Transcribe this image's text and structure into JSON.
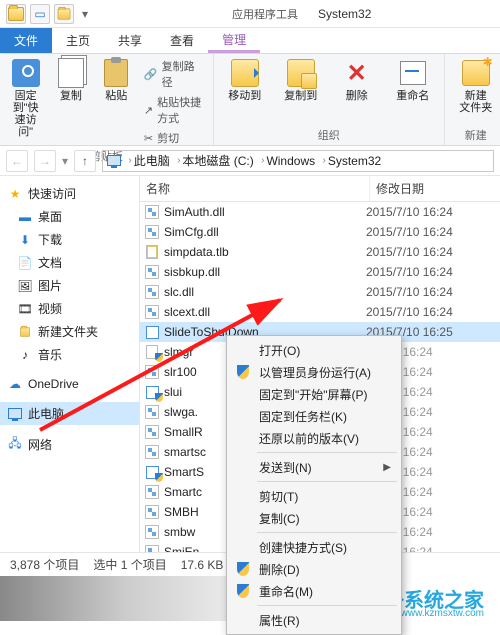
{
  "titlebar": {
    "contextual_tab": "应用程序工具",
    "window_title": "System32"
  },
  "tabs": {
    "file": "文件",
    "home": "主页",
    "share": "共享",
    "view": "查看",
    "manage": "管理"
  },
  "ribbon": {
    "pin": "固定到\"快\n速访问\"",
    "copy": "复制",
    "paste": "粘贴",
    "copy_path": "复制路径",
    "paste_shortcut": "粘贴快捷方式",
    "cut": "剪切",
    "grp_clipboard": "剪贴板",
    "move_to": "移动到",
    "copy_to": "复制到",
    "delete": "删除",
    "rename": "重命名",
    "grp_organize": "组织",
    "new_folder": "新建\n文件夹",
    "grp_new": "新建"
  },
  "breadcrumbs": {
    "b0": "此电脑",
    "b1": "本地磁盘 (C:)",
    "b2": "Windows",
    "b3": "System32"
  },
  "nav": {
    "quick": "快速访问",
    "desktop": "桌面",
    "downloads": "下载",
    "documents": "文档",
    "pictures": "图片",
    "videos": "视频",
    "newfolder": "新建文件夹",
    "music": "音乐",
    "onedrive": "OneDrive",
    "thispc": "此电脑",
    "network": "网络"
  },
  "columns": {
    "name": "名称",
    "modified": "修改日期"
  },
  "files": [
    {
      "name": "SimAuth.dll",
      "date": "2015/7/10 16:24",
      "icon": "dll"
    },
    {
      "name": "SimCfg.dll",
      "date": "2015/7/10 16:24",
      "icon": "dll"
    },
    {
      "name": "simpdata.tlb",
      "date": "2015/7/10 16:24",
      "icon": "tlb"
    },
    {
      "name": "sisbkup.dll",
      "date": "2015/7/10 16:24",
      "icon": "dll"
    },
    {
      "name": "slc.dll",
      "date": "2015/7/10 16:24",
      "icon": "dll"
    },
    {
      "name": "slcext.dll",
      "date": "2015/7/10 16:24",
      "icon": "dll"
    },
    {
      "name": "SlideToShutDown",
      "date": "2015/7/10 16:25",
      "icon": "exe",
      "selected": true
    },
    {
      "name": "slmgr",
      "date": "5/7/10 16:24",
      "icon": "scr",
      "shield": true,
      "cut": true
    },
    {
      "name": "slr100",
      "date": "5/7/10 16:24",
      "icon": "dll",
      "cut": true
    },
    {
      "name": "slui",
      "date": "5/7/10 16:24",
      "icon": "exe",
      "shield": true,
      "cut": true
    },
    {
      "name": "slwga.",
      "date": "5/7/10 16:24",
      "icon": "dll",
      "cut": true
    },
    {
      "name": "SmallR",
      "date": "5/7/10 16:24",
      "icon": "dll",
      "cut": true
    },
    {
      "name": "smartsc",
      "date": "5/7/10 16:24",
      "icon": "dll",
      "cut": true
    },
    {
      "name": "SmartS",
      "date": "5/7/10 16:24",
      "icon": "exe",
      "shield": true,
      "cut": true
    },
    {
      "name": "Smartc",
      "date": "5/7/10 16:24",
      "icon": "dll",
      "cut": true
    },
    {
      "name": "SMBH",
      "date": "5/7/10 16:24",
      "icon": "dll",
      "cut": true
    },
    {
      "name": "smbw",
      "date": "5/7/10 16:24",
      "icon": "dll",
      "cut": true
    },
    {
      "name": "SmiEn",
      "date": "5/7/10 16:24",
      "icon": "dll",
      "cut": true
    }
  ],
  "context_menu": {
    "open": "打开(O)",
    "run_admin": "以管理员身份运行(A)",
    "pin_start": "固定到\"开始\"屏幕(P)",
    "pin_taskbar": "固定到任务栏(K)",
    "restore": "还原以前的版本(V)",
    "send_to": "发送到(N)",
    "cut": "剪切(T)",
    "copy": "复制(C)",
    "shortcut": "创建快捷方式(S)",
    "delete": "删除(D)",
    "rename": "重命名(M)",
    "properties": "属性(R)"
  },
  "status": {
    "count": "3,878 个项目",
    "selected": "选中 1 个项目",
    "size": "17.6 KB"
  },
  "watermark": {
    "brand": "纯净系统之家",
    "url": "www.kzmsxtw.com"
  }
}
